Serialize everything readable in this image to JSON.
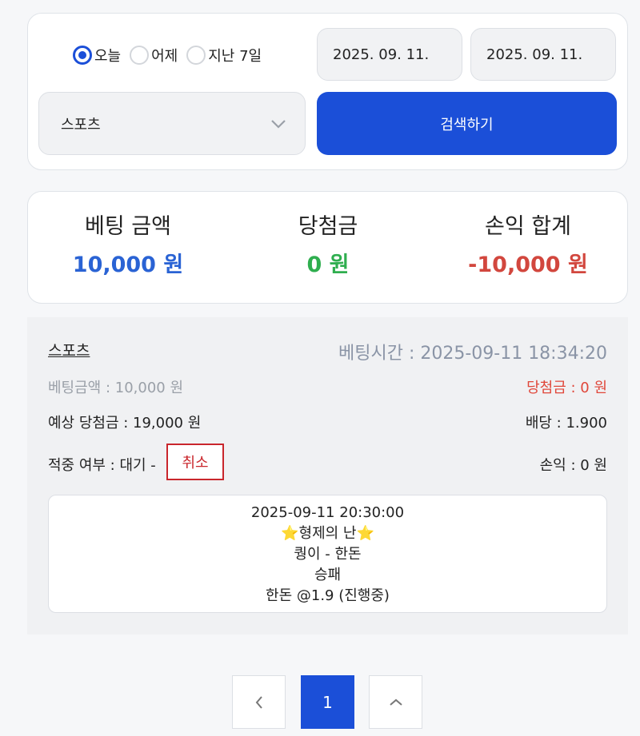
{
  "filter": {
    "radios": [
      {
        "label": "오늘",
        "checked": true
      },
      {
        "label": "어제",
        "checked": false
      },
      {
        "label": "지난 7일",
        "checked": false
      }
    ],
    "date_from": "2025. 09. 11.",
    "date_to": "2025. 09. 11.",
    "category": "스포츠",
    "search_label": "검색하기"
  },
  "summary": {
    "bet_label": "베팅 금액",
    "bet_value": "10,000 원",
    "win_label": "당첨금",
    "win_value": "0 원",
    "pl_label": "손익 합계",
    "pl_value": "-10,000 원"
  },
  "bet": {
    "category": "스포츠",
    "time": "베팅시간 : 2025-09-11 18:34:20",
    "amount": "베팅금액 : 10,000 원",
    "win": "당첨금 : 0 원",
    "expected": "예상 당첨금 : 19,000 원",
    "odds": "배당 : 1.900",
    "status": "적중 여부 : 대기 -",
    "cancel_label": "취소",
    "profit": "손익 : 0 원",
    "match": {
      "datetime": "2025-09-11 20:30:00",
      "title": "⭐형제의 난⭐",
      "teams": "퀑이 - 한돈",
      "market": "승패",
      "pick": "한돈 @1.9 (진행중)"
    }
  },
  "pagination": {
    "prev_icon": "chevron-left-icon",
    "current": "1",
    "next_icon": "chevron-up-icon"
  },
  "colors": {
    "primary": "#1b4fd8",
    "bet_blue": "#2a63d4",
    "win_green": "#2fae4f",
    "loss_red": "#d2473e",
    "cancel_red": "#c9262c"
  }
}
